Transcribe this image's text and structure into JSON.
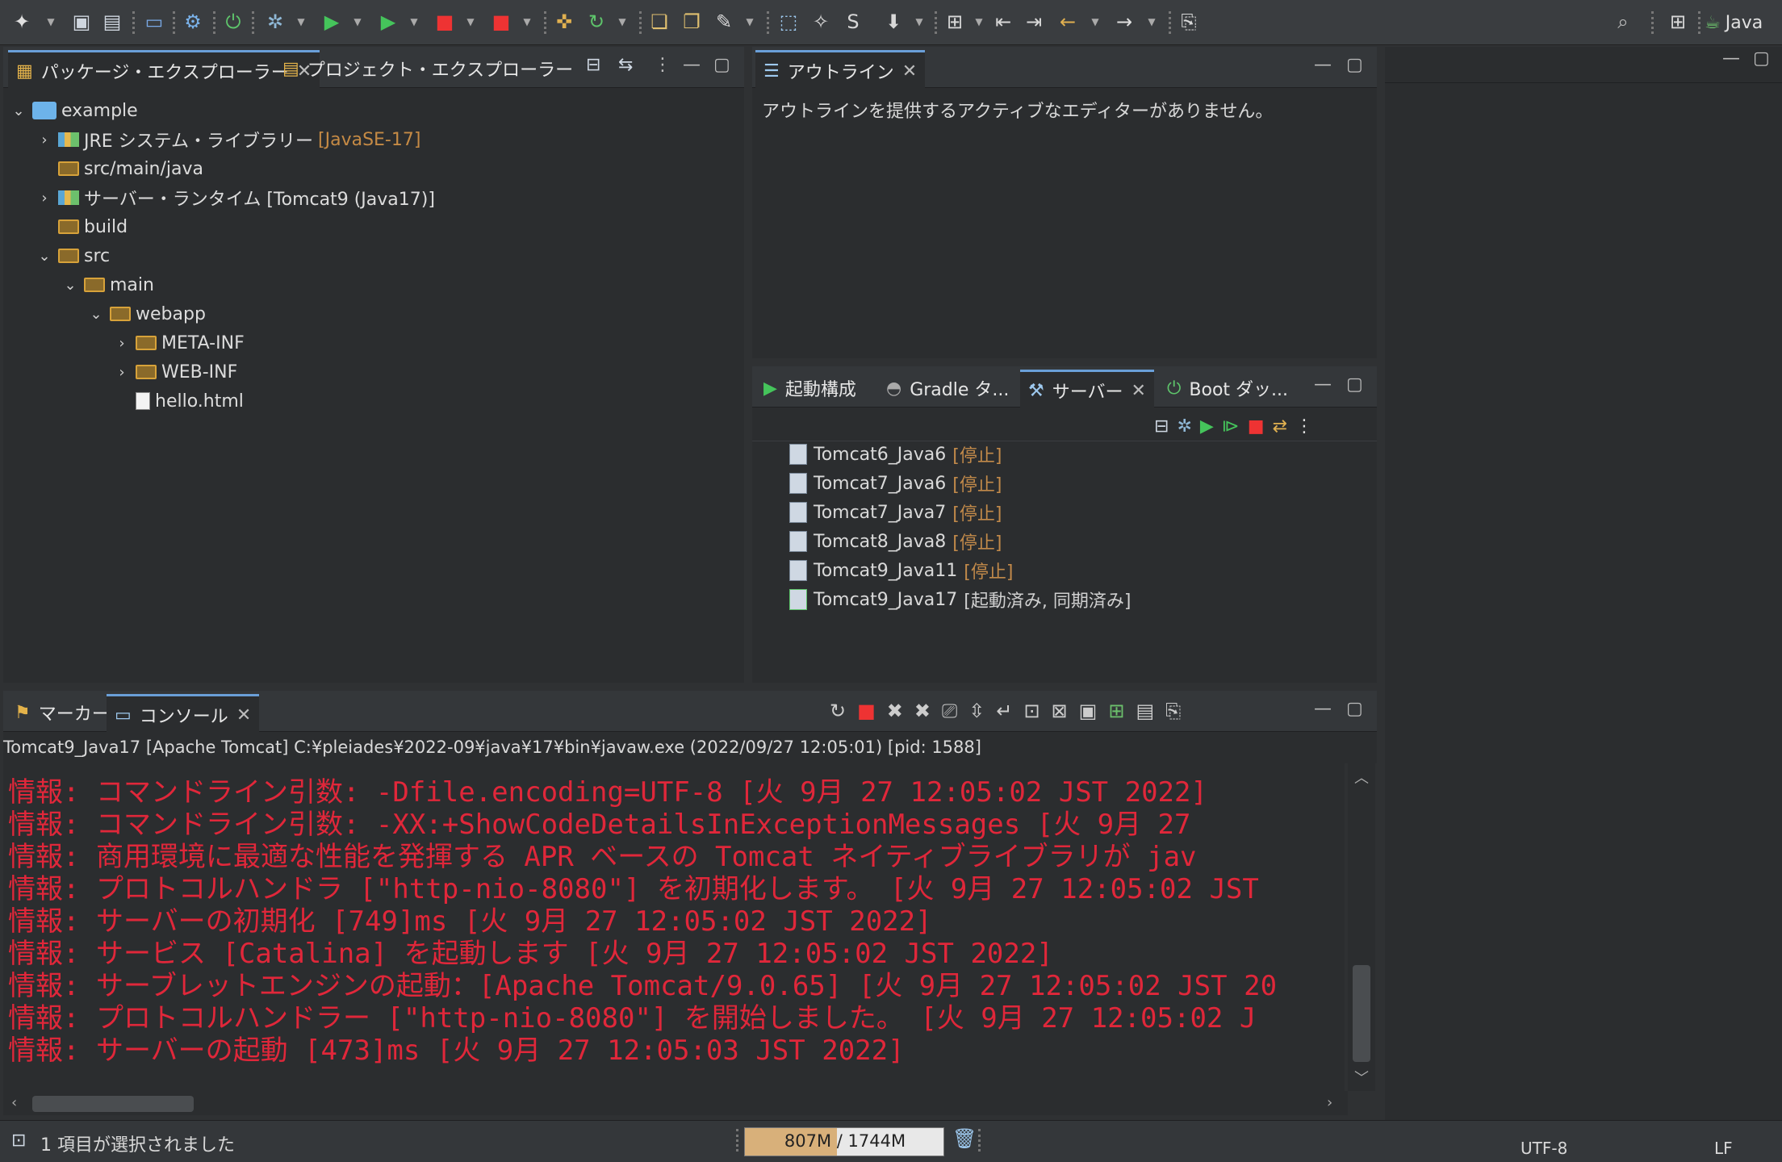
{
  "toolbar": {
    "perspective_label": "Java"
  },
  "package_explorer": {
    "tab_label": "パッケージ・エクスプローラー",
    "tab2_label": "プロジェクト・エクスプローラー",
    "tree": [
      {
        "label": "example",
        "indent": 0,
        "twisty": "open",
        "icon": "project-icon"
      },
      {
        "label": "JRE システム・ライブラリー",
        "suffix": "[JavaSE-17]",
        "indent": 1,
        "twisty": "closed",
        "icon": "library-icon"
      },
      {
        "label": "src/main/java",
        "indent": 1,
        "twisty": "none",
        "icon": "source-folder-icon"
      },
      {
        "label": "サーバー・ランタイム [Tomcat9 (Java17)]",
        "indent": 1,
        "twisty": "closed",
        "icon": "library-icon"
      },
      {
        "label": "build",
        "indent": 1,
        "twisty": "none",
        "icon": "folder-icon"
      },
      {
        "label": "src",
        "indent": 1,
        "twisty": "open",
        "icon": "folder-icon"
      },
      {
        "label": "main",
        "indent": 2,
        "twisty": "open",
        "icon": "folder-icon"
      },
      {
        "label": "webapp",
        "indent": 3,
        "twisty": "open",
        "icon": "folder-icon"
      },
      {
        "label": "META-INF",
        "indent": 4,
        "twisty": "closed",
        "icon": "folder-icon"
      },
      {
        "label": "WEB-INF",
        "indent": 4,
        "twisty": "closed",
        "icon": "folder-icon"
      },
      {
        "label": "hello.html",
        "indent": 4,
        "twisty": "none",
        "icon": "html-file-icon"
      }
    ]
  },
  "outline": {
    "tab_label": "アウトライン",
    "message": "アウトラインを提供するアクティブなエディターがありません。"
  },
  "servers_view": {
    "tabs": [
      "起動構成",
      "Gradle タ...",
      "サーバー",
      "Boot ダッ..."
    ],
    "servers": [
      {
        "name": "Tomcat6_Java6",
        "status": "[停止]",
        "running": false
      },
      {
        "name": "Tomcat7_Java6",
        "status": "[停止]",
        "running": false
      },
      {
        "name": "Tomcat7_Java7",
        "status": "[停止]",
        "running": false
      },
      {
        "name": "Tomcat8_Java8",
        "status": "[停止]",
        "running": false
      },
      {
        "name": "Tomcat9_Java11",
        "status": "[停止]",
        "running": false
      },
      {
        "name": "Tomcat9_Java17",
        "status": "[起動済み, 同期済み]",
        "running": true
      }
    ]
  },
  "console_view": {
    "tabs": [
      "マーカー",
      "コンソール"
    ],
    "process_line": "Tomcat9_Java17 [Apache Tomcat] C:¥pleiades¥2022-09¥java¥17¥bin¥javaw.exe  (2022/09/27 12:05:01) [pid: 1588]",
    "lines": [
      "情報: コマンドライン引数:       -Dfile.encoding=UTF-8 [火 9月 27 12:05:02 JST 2022]",
      "情報: コマンドライン引数:       -XX:+ShowCodeDetailsInExceptionMessages [火 9月 27",
      "情報: 商用環境に最適な性能を発揮する APR ベースの Tomcat ネイティブライブラリが jav",
      "情報: プロトコルハンドラ [\"http-nio-8080\"] を初期化します。 [火 9月 27 12:05:02 JST",
      "情報: サーバーの初期化 [749]ms [火 9月 27 12:05:02 JST 2022]",
      "情報: サービス [Catalina] を起動します [火 9月 27 12:05:02 JST 2022]",
      "情報: サーブレットエンジンの起動：[Apache Tomcat/9.0.65] [火 9月 27 12:05:02 JST 20",
      "情報: プロトコルハンドラー [\"http-nio-8080\"] を開始しました。 [火 9月 27 12:05:02 J",
      "情報: サーバーの起動 [473]ms [火 9月 27 12:05:03 JST 2022]"
    ]
  },
  "statusbar": {
    "selection_text": "1 項目が選択されました",
    "heap_text": "807M / 1744M",
    "heap_used_fraction": 0.463,
    "encoding": "UTF-8",
    "line_delimiter": "LF"
  },
  "colors": {
    "console_error": "#e0273a",
    "accent": "#6a9fd8",
    "status_muted": "#c28a4a"
  }
}
